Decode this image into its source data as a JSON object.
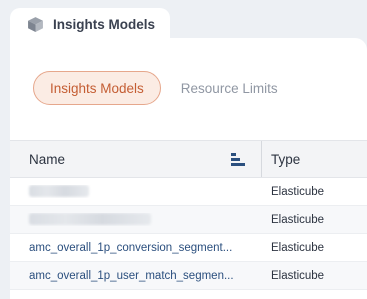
{
  "top_tab": {
    "label": "Insights Models",
    "icon": "cube-icon"
  },
  "pills": [
    {
      "label": "Insights Models",
      "active": true
    },
    {
      "label": "Resource Limits",
      "active": false
    }
  ],
  "table": {
    "columns": {
      "name": "Name",
      "type": "Type"
    },
    "rows": [
      {
        "name": "",
        "type": "Elasticube",
        "redacted": true
      },
      {
        "name": "",
        "type": "Elasticube",
        "redacted": true
      },
      {
        "name": "amc_overall_1p_conversion_segment...",
        "type": "Elasticube",
        "redacted": false
      },
      {
        "name": "amc_overall_1p_user_match_segmen...",
        "type": "Elasticube",
        "redacted": false
      }
    ]
  },
  "colors": {
    "accent": "#c45d33",
    "accent_bg": "#fbece4",
    "link": "#2b4f7e",
    "sort_icon": "#2b4f7e"
  }
}
